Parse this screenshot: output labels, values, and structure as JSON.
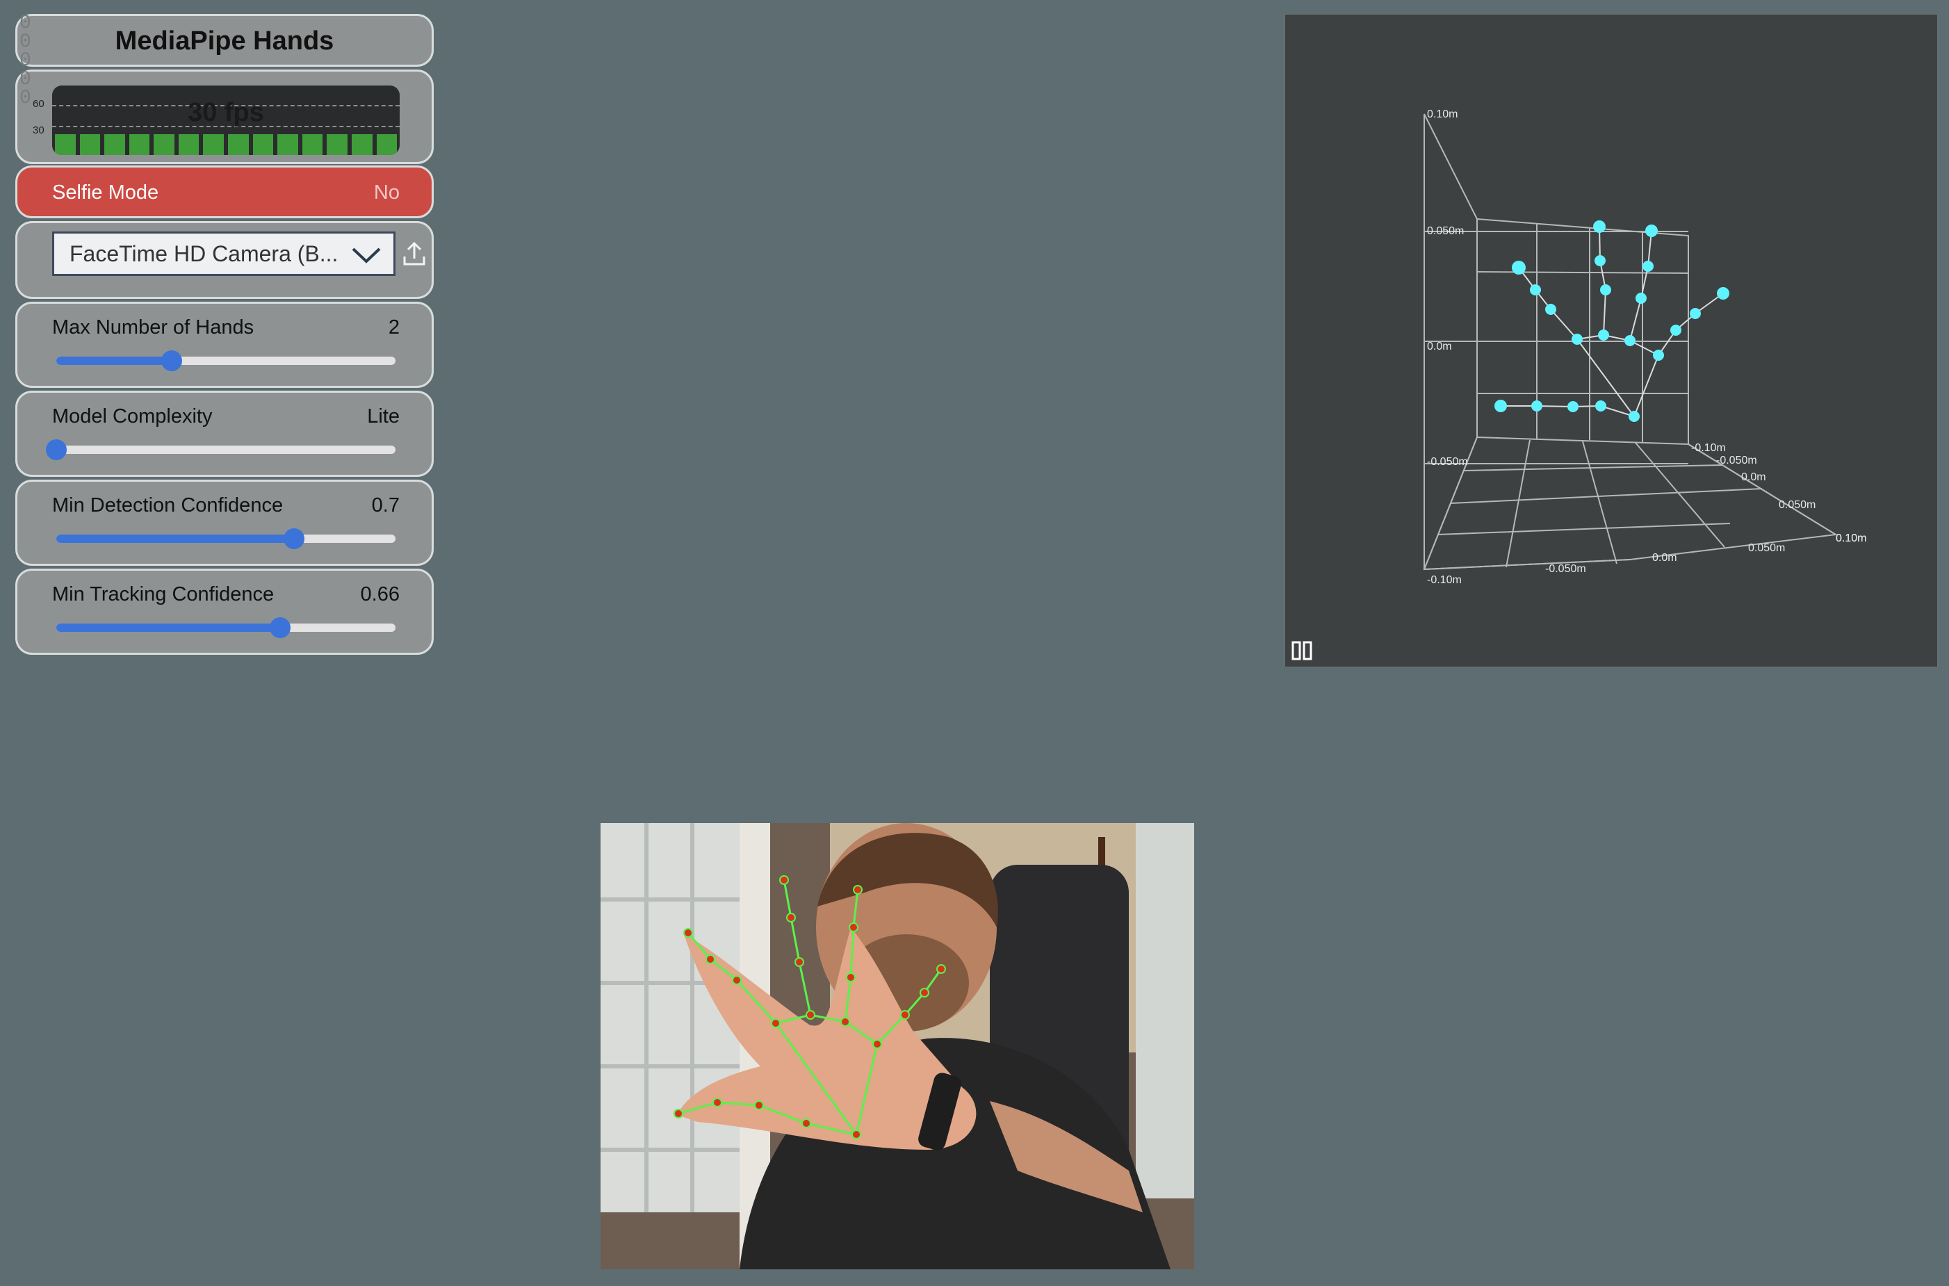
{
  "panel": {
    "title": "MediaPipe Hands",
    "side_stats": [
      "0",
      "0",
      "0",
      "0",
      "0"
    ],
    "fps": {
      "text": "30 fps",
      "label_high": "60",
      "label_low": "30"
    },
    "selfie": {
      "label": "Selfie Mode",
      "value": "No"
    },
    "camera": {
      "selected": "FaceTime HD Camera (B..."
    },
    "sliders": [
      {
        "label": "Max Number of Hands",
        "value": "2",
        "fraction": 0.34
      },
      {
        "label": "Model Complexity",
        "value": "Lite",
        "fraction": 0.0
      },
      {
        "label": "Min Detection Confidence",
        "value": "0.7",
        "fraction": 0.7
      },
      {
        "label": "Min Tracking Confidence",
        "value": "0.66",
        "fraction": 0.66
      }
    ]
  },
  "plot": {
    "z_ticks": [
      "0.10m",
      "0.050m",
      "0.0m",
      "-0.050m"
    ],
    "x_ticks": [
      "-0.10m",
      "-0.050m",
      "0.0m",
      "0.050m",
      "0.10m"
    ],
    "y_ticks": [
      "-0.10m",
      "-0.050m",
      "0.0m",
      "0.050m",
      "0.10m"
    ],
    "point_color": "#5ff2ff"
  },
  "colors": {
    "background": "#5e6d72",
    "selfie_red": "#cc4a44",
    "slider_blue": "#3b73d9",
    "landmark_red": "#d8321c",
    "connection_green": "#5af24a"
  }
}
